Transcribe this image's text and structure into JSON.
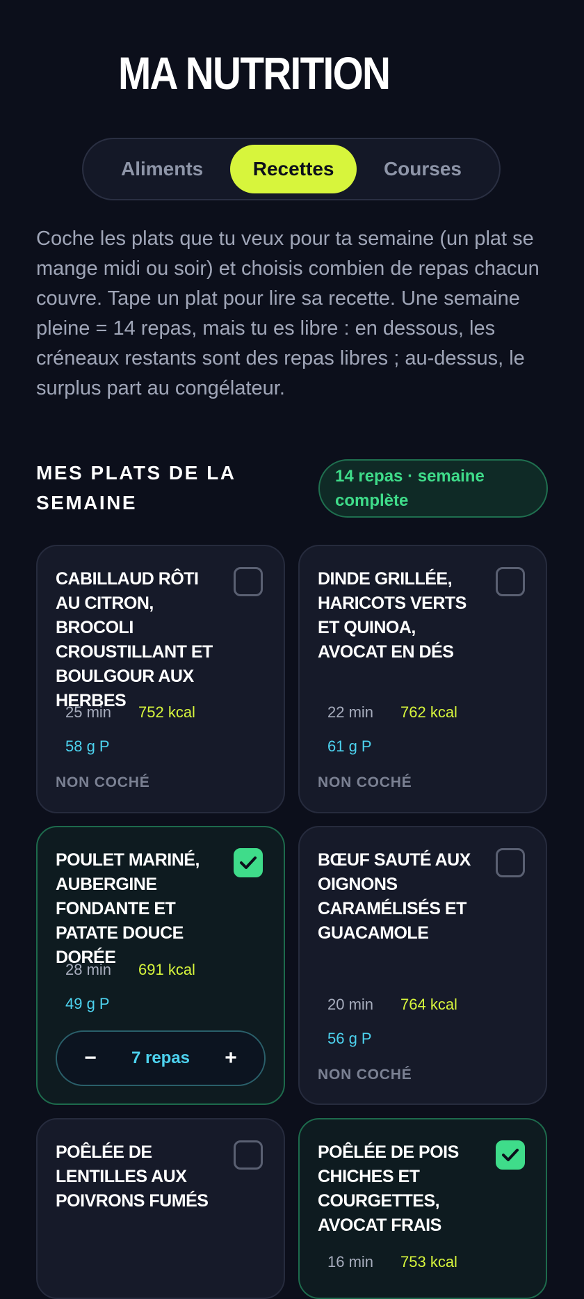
{
  "app": {
    "title": "MA NUTRITION"
  },
  "tabs": [
    {
      "label": "Aliments",
      "active": false
    },
    {
      "label": "Recettes",
      "active": true
    },
    {
      "label": "Courses",
      "active": false
    }
  ],
  "intro": "Coche les plats que tu veux pour ta semaine (un plat se mange midi ou soir) et choisis combien de repas chacun couvre. Tape un plat pour lire sa recette. Une semaine pleine = 14 repas, mais tu es libre : en dessous, les créneaux restants sont des repas libres ; au-dessus, le surplus part au congélateur.",
  "section": {
    "title": "MES PLATS DE LA SEMAINE",
    "badge": "14 repas · semaine complète"
  },
  "meals": [
    {
      "title": "Cabillaud rôti au citron, brocoli croustillant et boulgour aux herbes",
      "time": "25 min",
      "kcal": "752 kcal",
      "protein": "58 g P",
      "checked": false,
      "status": "NON COCHÉ"
    },
    {
      "title": "Dinde grillée, haricots verts et quinoa, avocat en dés",
      "time": "22 min",
      "kcal": "762 kcal",
      "protein": "61 g P",
      "checked": false,
      "status": "NON COCHÉ"
    },
    {
      "title": "Poulet mariné, aubergine fondante et patate douce dorée",
      "time": "28 min",
      "kcal": "691 kcal",
      "protein": "49 g P",
      "checked": true,
      "servings": "7 repas",
      "minus": "−",
      "plus": "+"
    },
    {
      "title": "Bœuf sauté aux oignons caramélisés et guacamole",
      "time": "20 min",
      "kcal": "764 kcal",
      "protein": "56 g P",
      "checked": false,
      "status": "NON COCHÉ"
    },
    {
      "title": "Poêlée de lentilles aux poivrons fumés",
      "checked": false
    },
    {
      "title": "Poêlée de pois chiches et courgettes, avocat frais",
      "time": "16 min",
      "kcal": "753 kcal",
      "checked": true
    }
  ],
  "colors": {
    "background": "#0c0f1b",
    "accent": "#d7f53c",
    "success": "#3fdc8a",
    "protein": "#4dd3ef"
  }
}
